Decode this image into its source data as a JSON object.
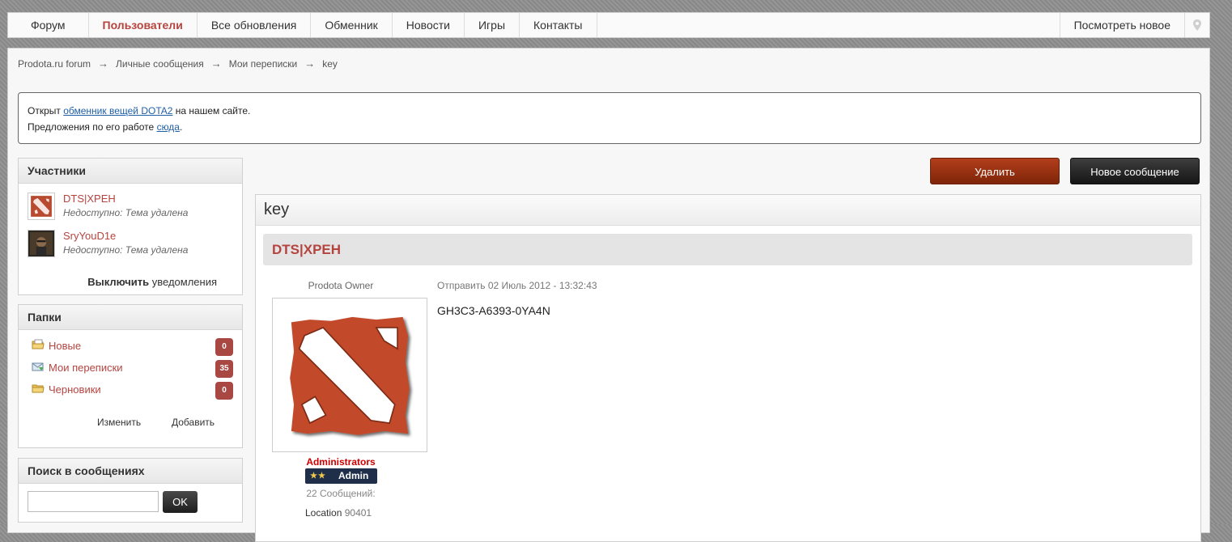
{
  "nav": {
    "items": [
      "Форум",
      "Пользователи",
      "Все обновления",
      "Обменник",
      "Новости",
      "Игры",
      "Контакты"
    ],
    "active_index": 1,
    "view_new": "Посмотреть новое"
  },
  "breadcrumb": [
    "Prodota.ru forum",
    "Личные сообщения",
    "Мои переписки",
    "key"
  ],
  "notice": {
    "line1_pre": "Открыт ",
    "line1_link": "обменник вещей DOTA2",
    "line1_post": " на нашем сайте.",
    "line2_pre": "Предложения по его работе ",
    "line2_link": "сюда",
    "line2_post": "."
  },
  "participants": {
    "title": "Участники",
    "members": [
      {
        "name": "DTS|XPEH",
        "status": "Недоступно: Тема удалена"
      },
      {
        "name": "SryYouD1e",
        "status": "Недоступно: Тема удалена"
      }
    ],
    "unsubscribe_bold": "Выключить",
    "unsubscribe_rest": " уведомления"
  },
  "folders": {
    "title": "Папки",
    "items": [
      {
        "label": "Новые",
        "count": "0"
      },
      {
        "label": "Мои переписки",
        "count": "35"
      },
      {
        "label": "Черновики",
        "count": "0"
      }
    ],
    "edit": "Изменить",
    "add": "Добавить"
  },
  "search": {
    "title": "Поиск в сообщениях",
    "value": "",
    "button": "OK"
  },
  "actions": {
    "delete": "Удалить",
    "new_message": "Новое сообщение"
  },
  "conversation": {
    "title": "key",
    "post": {
      "author": "DTS|XPEH",
      "rank": "Prodota Owner",
      "group": "Administrators",
      "badge": "Admin",
      "badge_stars": "★★",
      "post_count": "22 Сообщений:",
      "location_label": "Location",
      "location_value": "90401",
      "sent": "Отправить 02 Июль 2012 - 13:32:43",
      "body": "GH3C3-A6393-0YA4N"
    }
  },
  "colors": {
    "accent": "#b5443f",
    "delete_btn": "#9a300f",
    "dark_btn": "#222222",
    "group": "#cc0000"
  }
}
